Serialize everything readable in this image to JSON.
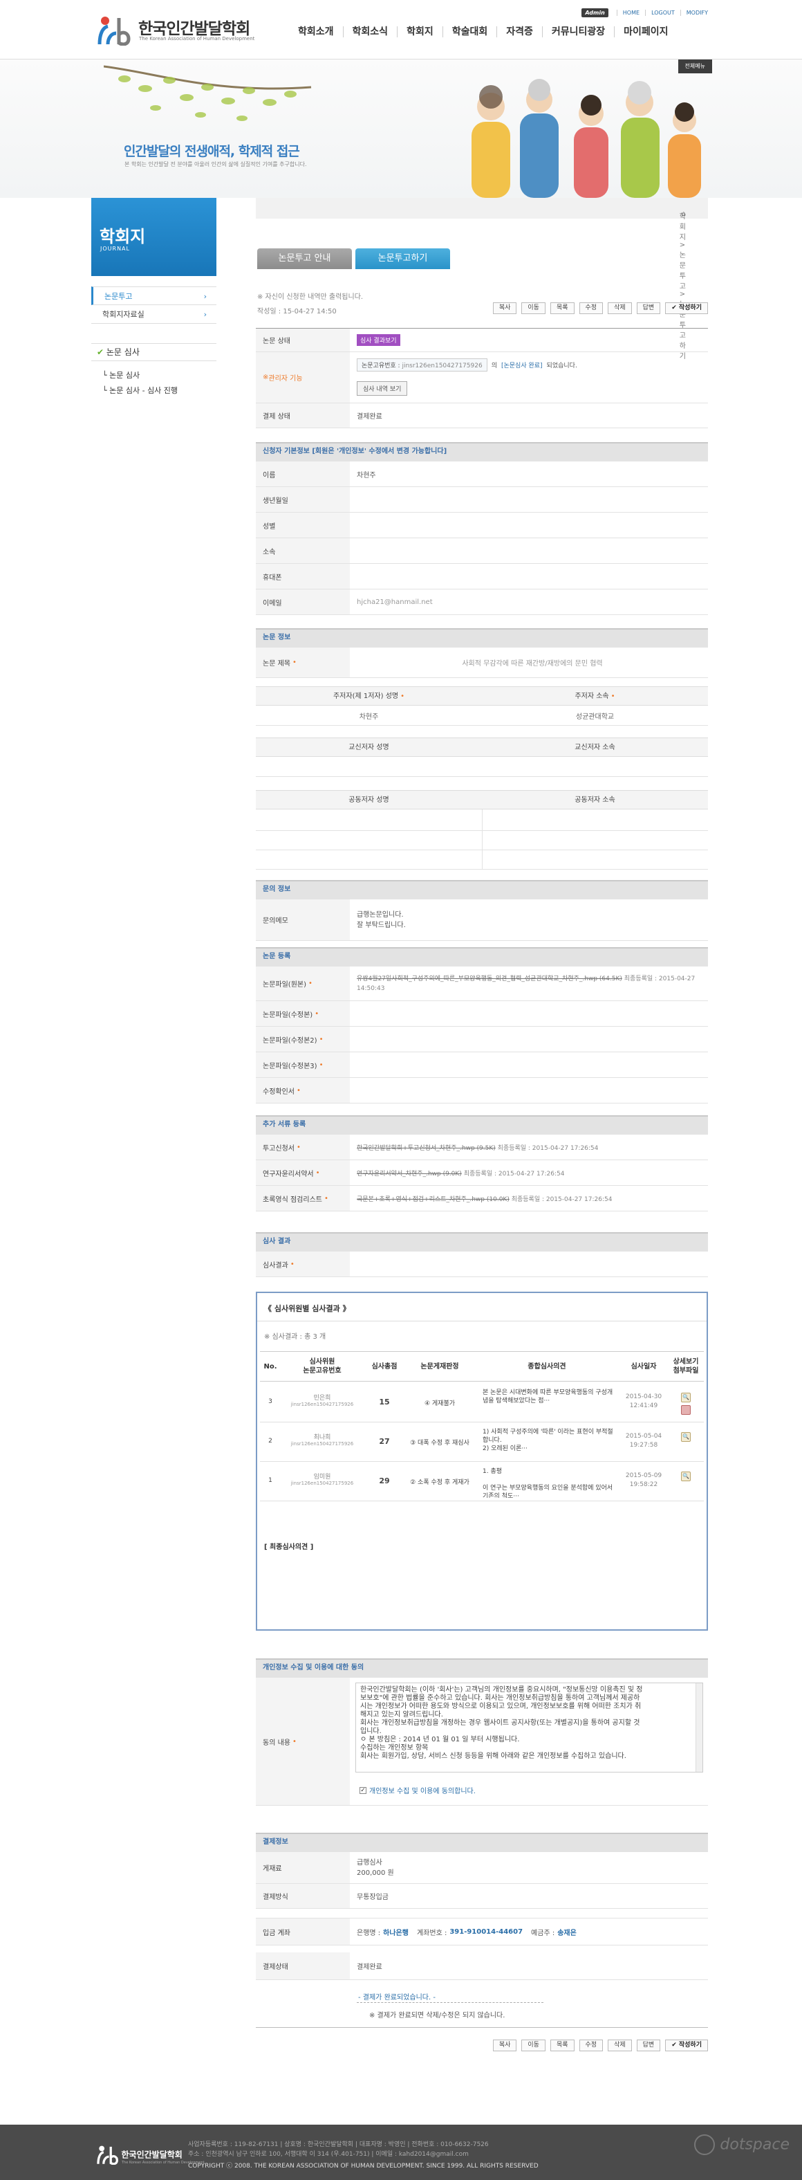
{
  "header": {
    "logo_ko": "한국인간발달학회",
    "logo_en": "The Korean Association of Human Development",
    "util": {
      "admin": "Admin",
      "home": "HOME",
      "logout": "LOGOUT",
      "modify": "MODIFY"
    },
    "gnb": [
      "학회소개",
      "학회소식",
      "학회지",
      "학술대회",
      "자격증",
      "커뮤니티광장",
      "마이페이지"
    ]
  },
  "visual": {
    "title": "인간발달의 전생애적, 학제적 접근",
    "sub": "본 학회는 인간발달 전 분야를 아울러 인간의 삶에 실질적인 기여를 추구합니다.",
    "btn": "전체메뉴"
  },
  "sidebar": {
    "title": "학회지",
    "title_en": "JOURNAL",
    "items": [
      "논문투고",
      "학회지자료실"
    ],
    "sub_title": "논문 심사",
    "sub_items": [
      "논문 심사",
      "논문 심사 - 심사 진행"
    ]
  },
  "breadcrumb": "학회지 > 논문투고 > 논문투고하기",
  "tabs": [
    "논문투고 안내",
    "논문투고하기"
  ],
  "notice": "※ 자신이 신청한 내역만 출력됩니다.",
  "written": "작성일 : 15-04-27 14:50",
  "buttons": [
    "복사",
    "이동",
    "목록",
    "수정",
    "삭제",
    "답변",
    "작성하기"
  ],
  "status": {
    "label_state": "논문 상태",
    "state_badge": "심사 결과보기",
    "label_admin": "관리자 기능",
    "paper_no_label": "논문고유번호 :",
    "paper_no": "jinsr126en150427175926",
    "paper_no_suffix": "의",
    "review_done_link": "[논문심사 완료]",
    "review_done_text": "되었습니다.",
    "view_btn": "심사 내역 보기",
    "label_pay": "결제 상태",
    "pay_state": "결제완료"
  },
  "applicant": {
    "header": "신청자 기본정보 [회원은 '개인정보' 수정에서 변경 가능합니다]",
    "labels": [
      "이름",
      "생년월일",
      "성별",
      "소속",
      "휴대폰",
      "이메일"
    ],
    "name": "차현주",
    "email": "hjcha21@hanmail.net"
  },
  "paper": {
    "header": "논문 정보",
    "label_title": "논문 제목",
    "title": "사회적 무감각에 따른 재간방/재방에의 문민 협력",
    "th_main_author": "주저자(제 1저자) 성명",
    "th_main_affil": "주저자 소속",
    "main_author": "차현주",
    "main_affil": "성균관대학교",
    "th_corr_author": "교신저자 성명",
    "th_corr_affil": "교신저자 소속",
    "th_co_author": "공동저자 성명",
    "th_co_affil": "공동저자 소속"
  },
  "inquiry": {
    "header": "문의 정보",
    "label": "문의메모",
    "lines": [
      "급행논문입니다.",
      "잘 부탁드립니다."
    ]
  },
  "registration": {
    "header": "논문 등록",
    "labels": [
      "논문파일(원본)",
      "논문파일(수정본)",
      "논문파일(수정본2)",
      "논문파일(수정본3)",
      "수정확인서"
    ],
    "file1": "유쌍4월27일사회적_구성주의에_따른_부모양육행동_의견_협력_성균관대학교_차현주_.hwp (64.5K)",
    "file1_date": "최종등록일 : 2015-04-27 14:50:43"
  },
  "extra": {
    "header": "추가 서류 등록",
    "labels": [
      "투고신청서",
      "연구자윤리서약서",
      "초록영식 점검리스트"
    ],
    "files": [
      "한국인간발달학회+투고신청서_차현주_.hwp (9.5K)",
      "연구자윤리서약서_차현주_.hwp (9.0K)",
      "국문본+초록+영식+점검+리스트_차현주_.hwp (10.0K)"
    ],
    "dates": [
      "최종등록일 : 2015-04-27 17:26:54",
      "최종등록일 : 2015-04-27 17:26:54",
      "최종등록일 : 2015-04-27 17:26:54"
    ]
  },
  "review_result": {
    "header": "심사 결과",
    "label": "심사결과"
  },
  "review_panel": {
    "title": "《 심사위원별 심사결과 》",
    "count": "※ 심사결과 : 총 3 개",
    "columns": [
      "No.",
      "심사위원\n논문고유번호",
      "심사총점",
      "논문게재판정",
      "종합심사의견",
      "심사일자",
      "상세보기\n첨부파일"
    ],
    "rows": [
      {
        "no": "3",
        "reviewer": "민은희",
        "id": "jinsr126en150427175926",
        "score": "15",
        "verdict": "④ 게재불가",
        "opinion": "본 논문은 시대변화에 따른 부모양육행동의 구성개념을 탐색해보았다는 점···",
        "date": "2015-04-30",
        "time": "12:41:49"
      },
      {
        "no": "2",
        "reviewer": "최나희",
        "id": "jinsr126en150427175926",
        "score": "27",
        "verdict": "③ 대폭 수정 후 재심사",
        "opinion": "1) 사회적 구성주의에 '따른' 이라는 표현이 부적절합니다.\n2) 오레된 이론···",
        "date": "2015-05-04",
        "time": "19:27:58"
      },
      {
        "no": "1",
        "reviewer": "임미원",
        "id": "jinsr126en150427175926",
        "score": "29",
        "verdict": "② 소폭 수정 후 게재가",
        "opinion": "1. 총평\n\n이 연구는 부모양육행동의 요인을 분석함에 있어서 기존의 척도···",
        "date": "2015-05-09",
        "time": "19:58:22"
      }
    ],
    "final": "[ 최종심사의견 ]"
  },
  "privacy": {
    "header": "개인정보 수집 및 이용에 대한 동의",
    "label": "동의 내용",
    "text": [
      "한국인간발달학회는 (이하 '회사'는) 고객님의 개인정보를 중요시하며, \"정보통신망 이용촉진 및 정",
      "보보호\"에 관한 법률을 준수하고 있습니다. 회사는 개인정보취급방침을 통하여 고객님께서 제공하",
      "시는 개인정보가 어떠한 용도와 방식으로 이용되고 있으며, 개인정보보호를 위해 어떠한 조치가 취",
      "해지고 있는지 알려드립니다.",
      "회사는 개인정보취급방침을 개정하는 경우 웹사이트 공지사항(또는 개별공지)을 통하여 공지할 것",
      "입니다.",
      "ㅇ 본 방침은 : 2014 년 01 월 01 일 부터 시행됩니다.",
      "",
      "수집하는 개인정보 항목",
      "회사는 회원가입, 상담, 서비스 신청 등등을 위해 아래와 같은 개인정보를 수집하고 있습니다."
    ],
    "agree": "개인정보 수집 및 이용에 동의합니다."
  },
  "payment": {
    "header": "결제정보",
    "label_type": "게재료",
    "type_name": "급행심사",
    "amount": "200,000 원",
    "label_method": "결제방식",
    "method": "무통장입금",
    "label_account": "입금 계좌",
    "bank_label": "은행명 :",
    "bank": "하나은행",
    "account_label": "계좌번호 :",
    "account": "391-910014-44607",
    "holder_label": "예금주 :",
    "holder": "송재은",
    "label_state": "결제상태",
    "state": "결제완료",
    "done_msg": "- 결제가 완료되었습니다. -",
    "warn_msg": "※ 결제가 완료되면 삭제/수정은 되지 않습니다."
  },
  "footer": {
    "logo": "한국인간발달학회",
    "logo_en": "The Korean Association of Human Development",
    "addr1": "사업자등록번호 : 119-82-67131   |   상호명 : 한국인간발달학회   |   대표자명 : 박영인   |   전화번호 : 010-6632-7526",
    "addr2": "주소 : 인천광역시 남구 인하로 100, 서행대학 이 314 (우.401-751)   |   이메일 : kahd2014@gmail.com",
    "copy": "COPYRIGHT ⓒ 2008. THE KOREAN ASSOCIATION OF HUMAN DEVELOPMENT. SINCE 1999. ALL RIGHTS RESERVED",
    "badge": "dotspace"
  },
  "colors": {
    "accent": "#2a88cc",
    "header_bg": "#e3e3e3",
    "review_border": "#7c9cc6",
    "footer": "#4b4b4b"
  }
}
